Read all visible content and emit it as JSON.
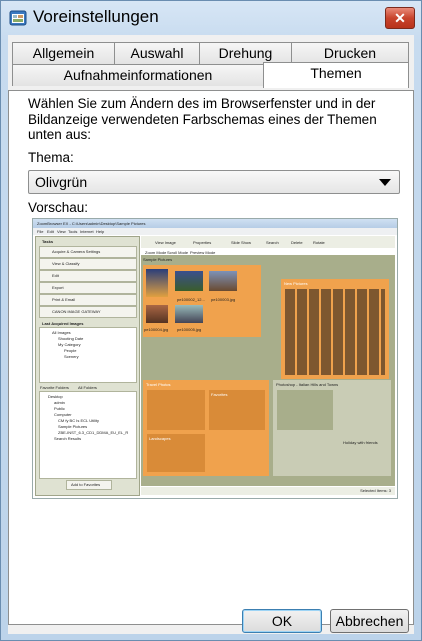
{
  "window": {
    "title": "Voreinstellungen",
    "close_label": "✕"
  },
  "tabs": {
    "row1": [
      "Allgemein",
      "Auswahl",
      "Drehung",
      "Drucken"
    ],
    "row2": [
      "Aufnahmeinformationen",
      "Themen"
    ],
    "active": "Themen"
  },
  "content": {
    "description": "Wählen Sie zum Ändern des im Browserfenster und in der Bildanzeige verwendeten Farbschemas eines der Themen unten aus:",
    "theme_label": "Thema:",
    "theme_value": "Olivgrün",
    "preview_label": "Vorschau:"
  },
  "preview": {
    "title": "ZoomBrowser EX - C:\\Users\\admin\\Desktop\\Sample Pictures",
    "menu": [
      "File",
      "Edit",
      "View",
      "Tools",
      "Internet",
      "Help"
    ],
    "tasks_header": "Tasks",
    "tasks": [
      "Acquire & Camera Settings",
      "View & Classify",
      "Edit",
      "Export",
      "Print & Email",
      "CANON iMAGE GATEWAY"
    ],
    "last_acquired": "Last Acquired Images",
    "tree_top": [
      "All Images",
      "Shooting Date",
      "My Category",
      "People",
      "Scenery"
    ],
    "folder_tabs": [
      "Favorite Folders",
      "All Folders"
    ],
    "folders": [
      "Desktop",
      "admin",
      "Public",
      "Computer",
      "CM fy BC Is ECL Utility",
      "Sample Pictures",
      "ZBE-INST_6.3_CD1_DDMA_EU_EL_R",
      "Search Results"
    ],
    "add_favorites": "Add to Favorites",
    "toolbar": [
      "View Image",
      "Properties",
      "Slide Show",
      "Search",
      "Delete",
      "Rotate"
    ],
    "mode_tabs": [
      "Zoom Mode",
      "Scroll Mode",
      "Preview Mode"
    ],
    "folder_name": "Sample Pictures",
    "thumbs": [
      "pe100001.jpg",
      "pe100002_12...",
      "pe100003.jpg",
      "pe100004.jpg",
      "pe100005.jpg"
    ],
    "group_a": "New Pictures",
    "group_b": "Travel Photos",
    "group_c": "Favorites",
    "group_d": "Landscapes",
    "group_e": "Photoshop - Italian Hills and Towns",
    "group_f": "Holiday with friends",
    "statusbar": "Selected Items: 3",
    "colors": {
      "olive": "#a8ae8b",
      "orange": "#f0a24d",
      "panel": "#c9ccb5"
    }
  },
  "buttons": {
    "ok": "OK",
    "cancel": "Abbrechen"
  }
}
